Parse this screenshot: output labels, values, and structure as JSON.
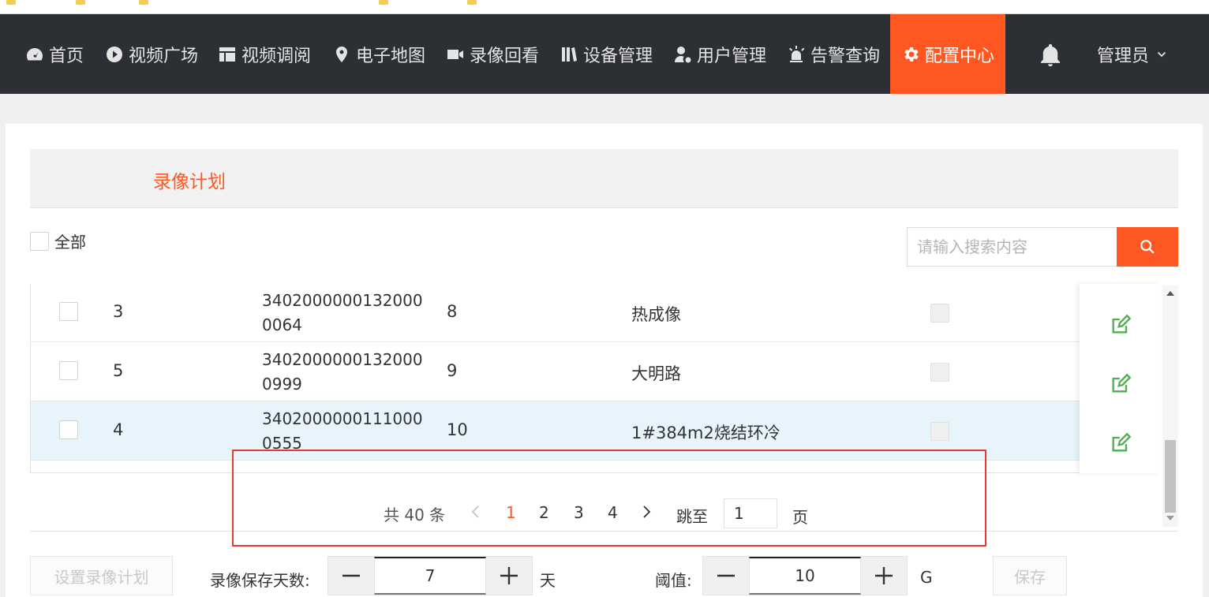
{
  "nav": {
    "items": [
      {
        "label": "首页",
        "icon": "dashboard-icon"
      },
      {
        "label": "视频广场",
        "icon": "play-circle-icon"
      },
      {
        "label": "视频调阅",
        "icon": "layout-icon"
      },
      {
        "label": "电子地图",
        "icon": "map-pin-icon"
      },
      {
        "label": "录像回看",
        "icon": "video-camera-icon"
      },
      {
        "label": "设备管理",
        "icon": "device-icon"
      },
      {
        "label": "用户管理",
        "icon": "user-gear-icon"
      },
      {
        "label": "告警查询",
        "icon": "alarm-icon"
      },
      {
        "label": "配置中心",
        "icon": "gear-icon"
      }
    ],
    "active_label": "配置中心",
    "user": "管理员",
    "accent": "#ff5722",
    "bg": "#2c2f33"
  },
  "tab": {
    "label": "录像计划"
  },
  "select_all": {
    "label": "全部"
  },
  "search": {
    "placeholder": "请输入搜索内容",
    "icon": "search-icon"
  },
  "table": {
    "rows": [
      {
        "id": "3",
        "code_line1": "3402000000132000",
        "code_line2": "0064",
        "channel": "8",
        "name": "热成像"
      },
      {
        "id": "5",
        "code_line1": "3402000000132000",
        "code_line2": "0999",
        "channel": "9",
        "name": "大明路"
      },
      {
        "id": "4",
        "code_line1": "3402000000111000",
        "code_line2": "0555",
        "channel": "10",
        "name": "1#384m2烧结环冷"
      }
    ],
    "edit_icon": "edit-icon",
    "highlight_color": "#e8f4fc"
  },
  "pagination": {
    "total_text": "共 40 条",
    "pages": [
      "1",
      "2",
      "3",
      "4"
    ],
    "current": "1",
    "jump_label": "跳至",
    "jump_value": "1",
    "page_word": "页"
  },
  "footer": {
    "set_plan_label": "设置录像计划",
    "days_label": "录像保存天数:",
    "days_value": "7",
    "days_unit": "天",
    "threshold_label": "阈值:",
    "threshold_value": "10",
    "threshold_unit": "G",
    "save_label": "保存"
  }
}
